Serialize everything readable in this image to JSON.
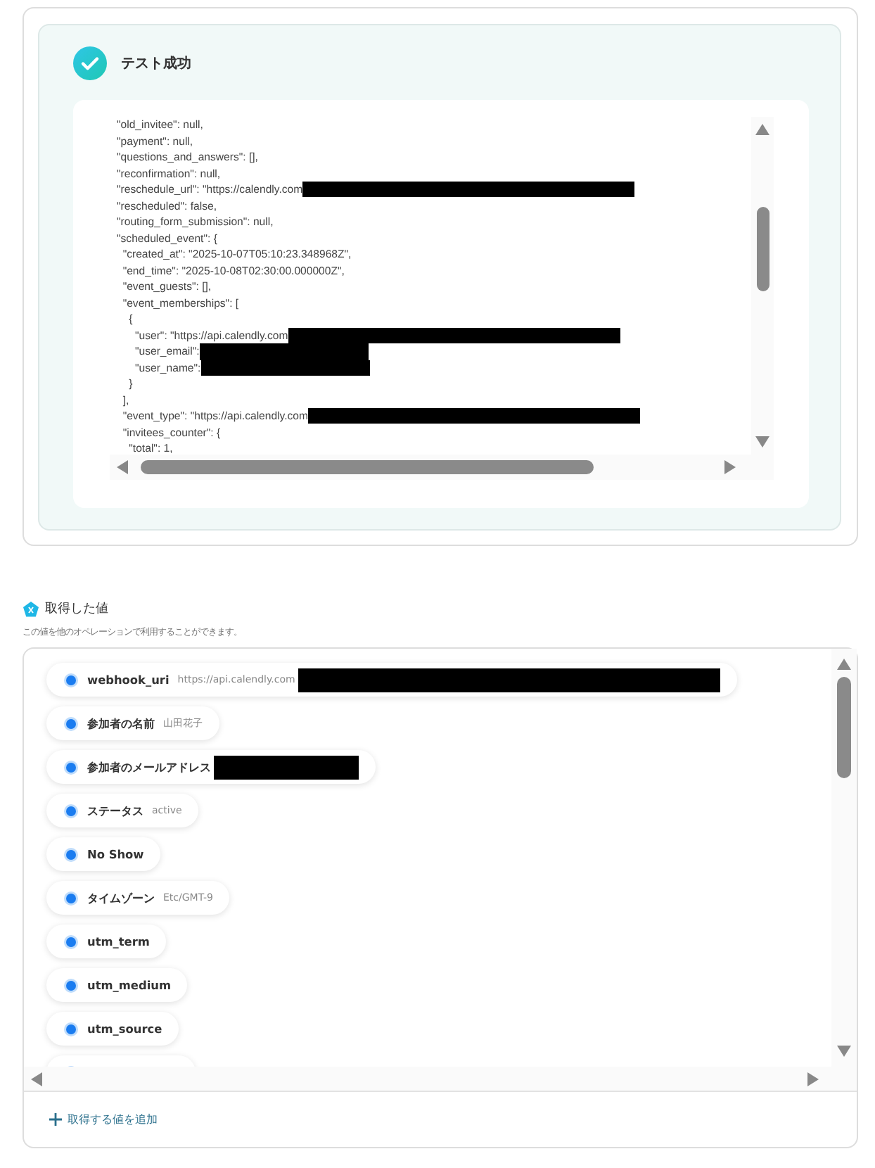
{
  "test_result": {
    "title": "テスト成功",
    "code_lines": [
      {
        "text": "\"old_invitee\": null,"
      },
      {
        "text": "\"payment\": null,"
      },
      {
        "text": "\"questions_and_answers\": [],"
      },
      {
        "text": "\"reconfirmation\": null,"
      },
      {
        "text": "\"reschedule_url\": \"https://calendly.com",
        "redacted": true
      },
      {
        "text": "\"rescheduled\": false,"
      },
      {
        "text": "\"routing_form_submission\": null,"
      },
      {
        "text": "\"scheduled_event\": {"
      },
      {
        "text": "  \"created_at\": \"2025-10-07T05:10:23.348968Z\","
      },
      {
        "text": "  \"end_time\": \"2025-10-08T02:30:00.000000Z\","
      },
      {
        "text": "  \"event_guests\": [],"
      },
      {
        "text": "  \"event_memberships\": ["
      },
      {
        "text": "    {"
      },
      {
        "text": "      \"user\": \"https://api.calendly.com",
        "redacted": true
      },
      {
        "text": "      \"user_email\":",
        "redacted": true
      },
      {
        "text": "      \"user_name\":",
        "redacted": true
      },
      {
        "text": "    }"
      },
      {
        "text": "  ],"
      },
      {
        "text": "  \"event_type\": \"https://api.calendly.com",
        "redacted": true
      },
      {
        "text": "  \"invitees_counter\": {"
      },
      {
        "text": "    \"total\": 1,"
      }
    ]
  },
  "retrieved_values": {
    "title": "取得した値",
    "description": "この値を他のオペレーションで利用することができます。",
    "items": [
      {
        "name": "webhook_uri",
        "value": "https://api.calendly.com",
        "redacted": true
      },
      {
        "name": "参加者の名前",
        "value": "山田花子"
      },
      {
        "name": "参加者のメールアドレス",
        "redacted": true
      },
      {
        "name": "ステータス",
        "value": "active"
      },
      {
        "name": "No Show"
      },
      {
        "name": "タイムゾーン",
        "value": "Etc/GMT-9"
      },
      {
        "name": "utm_term"
      },
      {
        "name": "utm_medium"
      },
      {
        "name": "utm_source"
      }
    ],
    "add_button": "取得する値を追加"
  }
}
